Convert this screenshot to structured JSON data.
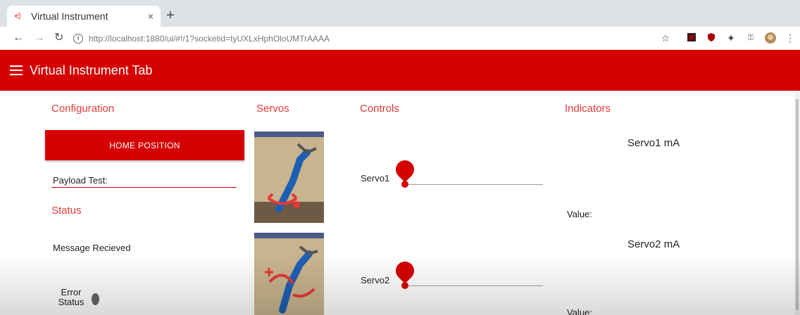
{
  "browser": {
    "tab_title": "Virtual Instrument",
    "tab_close": "×",
    "new_tab": "+",
    "url": "http://localhost:1880/ui/#!/1?socketid=tyUXLxHphOloUMTrAAAA",
    "info_glyph": "i"
  },
  "header": {
    "title": "Virtual Instrument Tab"
  },
  "configuration": {
    "title": "Configuration",
    "home_button": "HOME POSITION",
    "payload_label": "Payload Test:"
  },
  "status": {
    "title": "Status",
    "message": "Message Recieved",
    "error_label": "Error Status"
  },
  "servos": {
    "title": "Servos"
  },
  "controls": {
    "title": "Controls",
    "sliders": [
      {
        "label": "Servo1",
        "value_fraction": 0.0
      },
      {
        "label": "Servo2",
        "value_fraction": 0.0
      }
    ]
  },
  "indicators": {
    "title": "Indicators",
    "items": [
      {
        "name": "Servo1 mA",
        "value_label": "Value:"
      },
      {
        "name": "Servo2 mA",
        "value_label": "Value:"
      }
    ]
  },
  "colors": {
    "accent": "#d50000",
    "title_red": "#e53935"
  },
  "icons": [
    "favicon-icon",
    "back-icon",
    "forward-icon",
    "reload-icon",
    "info-icon",
    "star-icon",
    "extension-icon",
    "shield-icon",
    "puzzle-icon",
    "key-icon",
    "profile-icon",
    "menu-dots-icon",
    "hamburger-icon"
  ]
}
